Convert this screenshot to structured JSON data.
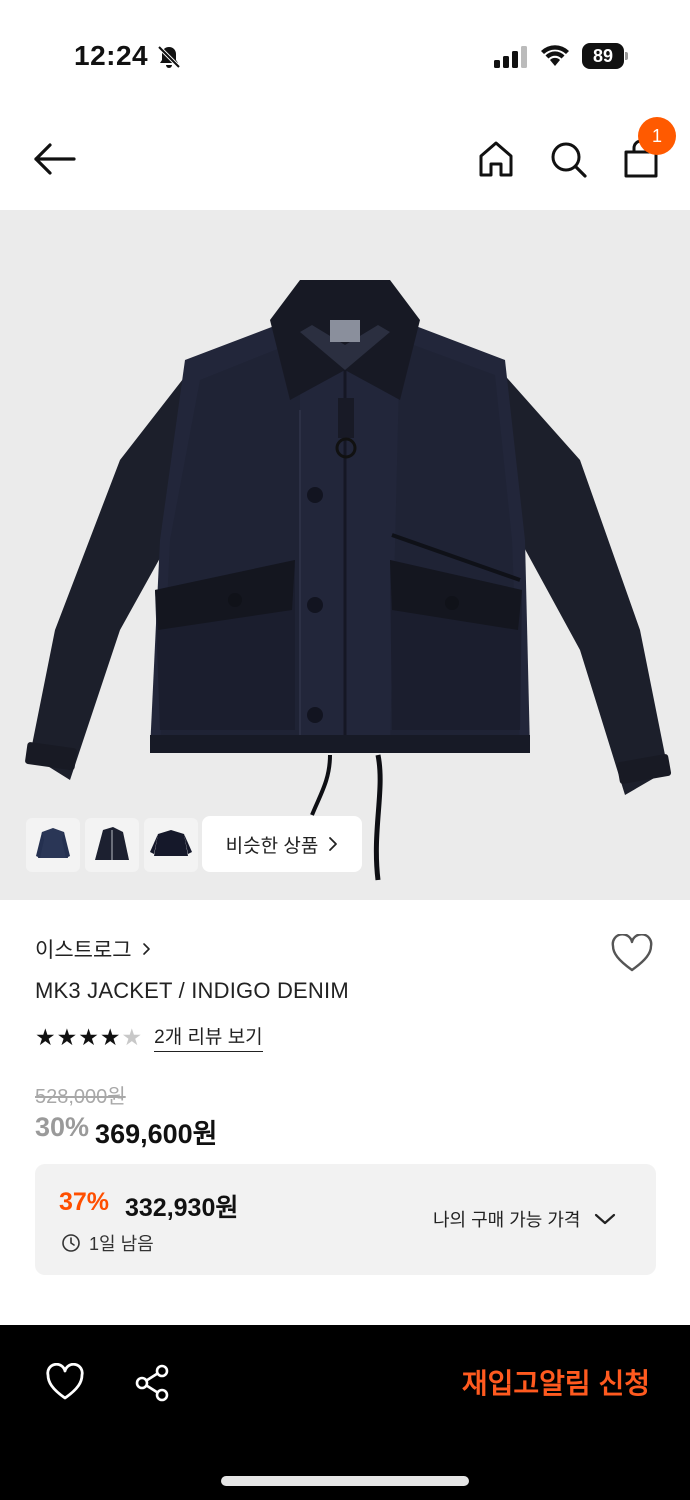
{
  "status_bar": {
    "time": "12:24",
    "battery": "89"
  },
  "header": {
    "cart_count": "1"
  },
  "gallery": {
    "similar_label": "비슷한 상품",
    "thumbnail_count": 3
  },
  "product": {
    "brand": "이스트로그",
    "name": "MK3 JACKET / INDIGO DENIM",
    "rating": 4,
    "rating_max": 5,
    "review_link": "2개 리뷰 보기",
    "original_price": "528,000원",
    "discount_rate": "30%",
    "sale_price": "369,600원"
  },
  "my_price": {
    "rate": "37%",
    "value": "332,930원",
    "remaining": "1일 남음",
    "label": "나의 구매 가능 가격"
  },
  "bottom_bar": {
    "restock_label": "재입고알림 신청"
  },
  "colors": {
    "accent": "#ff5a00",
    "discount_orange": "#ff4f00",
    "background_gray": "#ebebeb"
  }
}
